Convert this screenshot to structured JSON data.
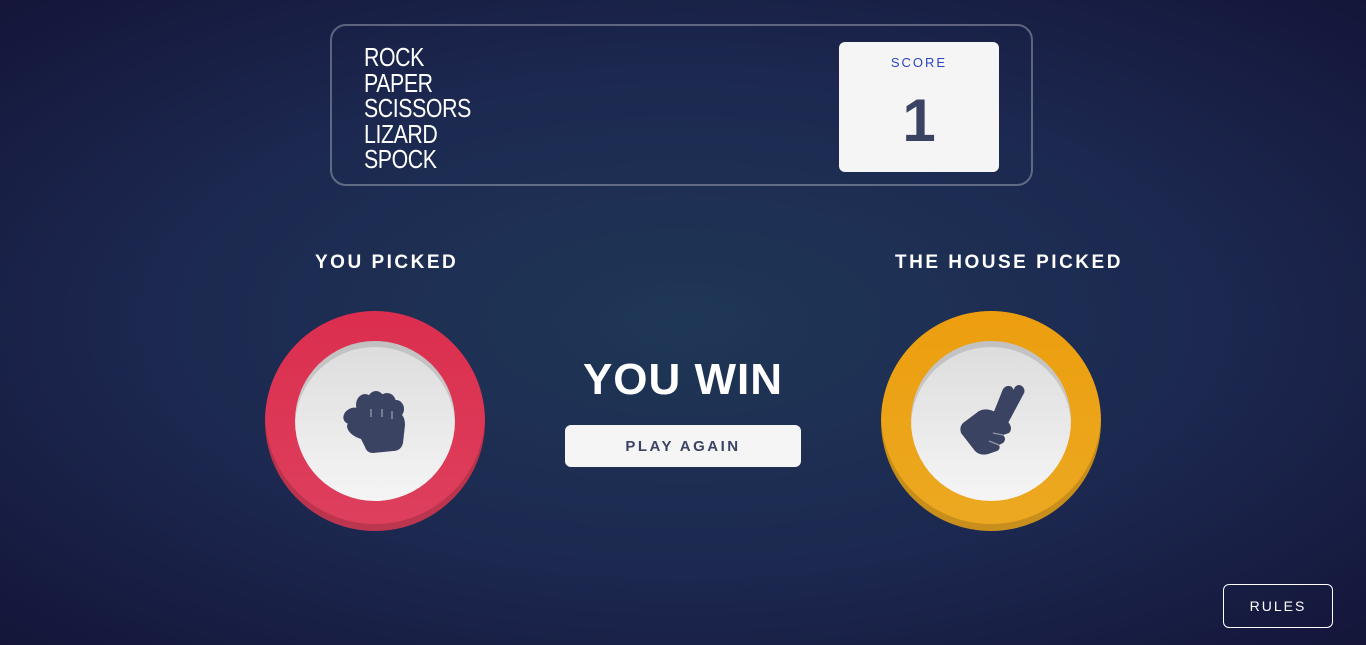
{
  "header": {
    "title_lines": [
      "ROCK",
      "PAPER",
      "SCISSORS",
      "LIZARD",
      "SPOCK"
    ],
    "score_label": "SCORE",
    "score_value": "1"
  },
  "game": {
    "you_picked_label": "YOU PICKED",
    "house_picked_label": "THE HOUSE PICKED",
    "player_pick": {
      "name": "rock",
      "icon": "rock-fist-icon",
      "ring_color": "#dc2e4e"
    },
    "house_pick": {
      "name": "scissors",
      "icon": "scissors-hand-icon",
      "ring_color": "#ec9e0e"
    },
    "result_text": "YOU WIN",
    "play_again_label": "PLAY AGAIN"
  },
  "footer": {
    "rules_label": "RULES"
  },
  "colors": {
    "icon_dark": "#3b4363",
    "score_label": "#2a45c2"
  }
}
